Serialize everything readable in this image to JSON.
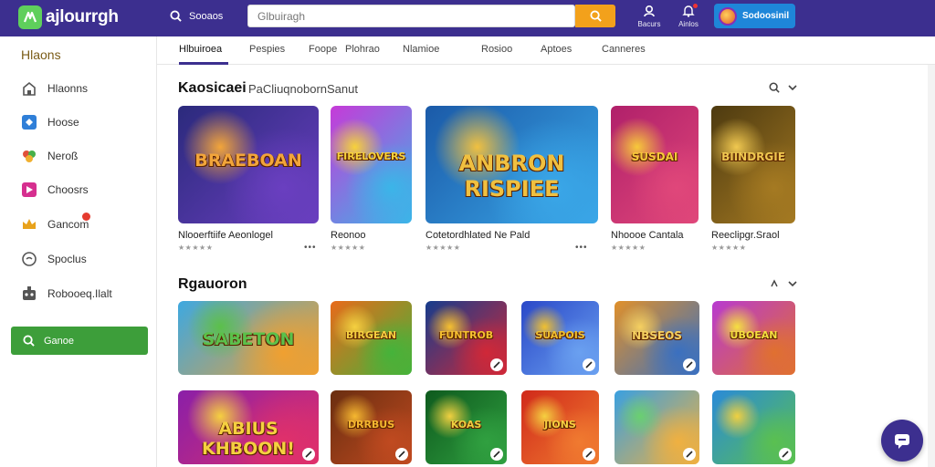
{
  "app": {
    "logo_text": "ajlourrgh",
    "search_label": "Sooaos",
    "search_placeholder": "Glbuiragh",
    "top_icons": [
      {
        "name": "alerts",
        "label": "Bacurs"
      },
      {
        "name": "notifications",
        "label": "Ainlos"
      }
    ],
    "account_label": "Sodoosinil"
  },
  "sidebar": {
    "heading": "Hlaons",
    "items": [
      {
        "label": "Hlaonns",
        "icon": "controller-icon"
      },
      {
        "label": "Hoose",
        "icon": "puzzle-icon"
      },
      {
        "label": "Neroß",
        "icon": "leaf-icon"
      },
      {
        "label": "Choosrs",
        "icon": "controller-pink-icon"
      },
      {
        "label": "Gancom",
        "icon": "crown-icon"
      },
      {
        "label": "Spoclus",
        "icon": "chat-bubble-icon"
      },
      {
        "label": "Robooeq.Ilalt",
        "icon": "robot-icon"
      }
    ],
    "search_button": "Ganoe"
  },
  "tabs": [
    "Hlbuiroea",
    "Pespies",
    "Foope",
    "Plohrao",
    "Nlamioe",
    "Rosioo",
    "Aptoes",
    "Canneres"
  ],
  "section1": {
    "title": "Kaosicaei",
    "subtitle": "PaCliuqnobornSanut",
    "games": [
      {
        "name": "Nlooerftiife Aeonlogel",
        "rating": "★★★★★",
        "art": "BRAEBOAN",
        "colors": [
          "#2b2a7c",
          "#6a3fc0",
          "#f2a53a"
        ]
      },
      {
        "name": "Reonoo",
        "rating": "★★★★★",
        "art": "FIRELOVERS",
        "colors": [
          "#c63ad8",
          "#3bb5e8",
          "#f7d23a"
        ]
      },
      {
        "name": "Cotetordhlated Ne Pald",
        "rating": "★★★★★",
        "art": "ANBRON RISPIEE",
        "colors": [
          "#1b5aa8",
          "#3aa7e8",
          "#f0c040"
        ]
      },
      {
        "name": "Nhoooe Cantala",
        "rating": "★★★★★",
        "art": "SUSDAI",
        "colors": [
          "#b0206a",
          "#e0477a",
          "#f7c93a"
        ]
      },
      {
        "name": "Reeclipgr.Sraol",
        "rating": "★★★★★",
        "art": "BIINDRGIE",
        "colors": [
          "#4d3a10",
          "#a57a22",
          "#f0c850"
        ]
      }
    ]
  },
  "section2": {
    "title": "Rgauoron",
    "row1": [
      {
        "art": "SABETON",
        "colors": [
          "#3ea8e0",
          "#f0a030",
          "#5bc04a"
        ]
      },
      {
        "art": "BIRGEAN",
        "colors": [
          "#e86a1a",
          "#45b33a",
          "#f5d040"
        ]
      },
      {
        "art": "FUNTROB",
        "colors": [
          "#163c8c",
          "#d02838",
          "#f5c030"
        ]
      },
      {
        "art": "SUAPOIS",
        "colors": [
          "#2a48c8",
          "#6aa0f0",
          "#f0c030"
        ]
      },
      {
        "art": "NBSEOS",
        "colors": [
          "#e0902a",
          "#3a70c0",
          "#f5d060"
        ]
      },
      {
        "art": "UBOEAN",
        "colors": [
          "#b83ad0",
          "#e07030",
          "#f5e040"
        ]
      }
    ],
    "row2": [
      {
        "art": "ABIUS KHBOON!",
        "colors": [
          "#8a1fa8",
          "#e0306a",
          "#f5d040"
        ]
      },
      {
        "art": "DRRBUS",
        "colors": [
          "#6a2e10",
          "#c04a20",
          "#f5b830"
        ]
      },
      {
        "art": "KOAS",
        "colors": [
          "#0e5a1e",
          "#30a040",
          "#f0d040"
        ]
      },
      {
        "art": "JIONS",
        "colors": [
          "#d02a1a",
          "#f07a30",
          "#f5d040"
        ]
      },
      {
        "art": "",
        "colors": [
          "#3aa0e0",
          "#f0b040",
          "#6ad070"
        ]
      },
      {
        "art": "",
        "colors": [
          "#2a8ad8",
          "#5ac050",
          "#f0d040"
        ]
      }
    ]
  }
}
